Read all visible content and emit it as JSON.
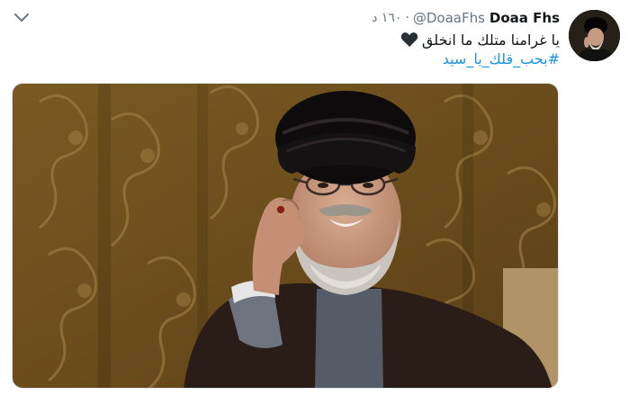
{
  "tweet": {
    "display_name": "Doaa Fhs",
    "handle": "@DoaaFhs",
    "separator": "·",
    "time": "١٦٠ د",
    "text": "يا غرامنا متلك ما انخلق",
    "emoji_icon": "black-heart-icon",
    "hashtag": "#بحب_قلك_يا_سيد"
  },
  "icons": {
    "menu": "chevron-down-icon",
    "avatar": "avatar"
  },
  "colors": {
    "link": "#1b95e0",
    "secondary_text": "#657786",
    "primary_text": "#14171a"
  }
}
